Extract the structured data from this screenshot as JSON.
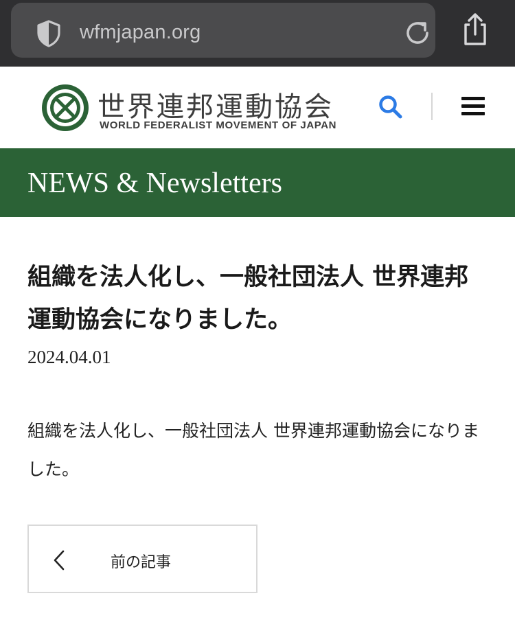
{
  "browser": {
    "url": "wfmjapan.org"
  },
  "header": {
    "logo_jp": "世界連邦運動協会",
    "logo_en": "WORLD FEDERALIST MOVEMENT OF JAPAN"
  },
  "page_band": {
    "title": "NEWS & Newsletters"
  },
  "article": {
    "title": "組織を法人化し、一般社団法人 世界連邦運動協会になりました。",
    "date": "2024.04.01",
    "body": "組織を法人化し、一般社団法人 世界連邦運動協会になりました。"
  },
  "navigation": {
    "prev_label": "前の記事"
  },
  "colors": {
    "brand_green": "#2b6236",
    "search_blue": "#2c7be5",
    "browser_bg": "#2f2f31"
  },
  "icons": {
    "shield": "shield-icon",
    "reload": "reload-icon",
    "share": "share-icon",
    "search": "search-icon",
    "menu": "hamburger-menu-icon",
    "prev": "chevron-left-icon"
  }
}
